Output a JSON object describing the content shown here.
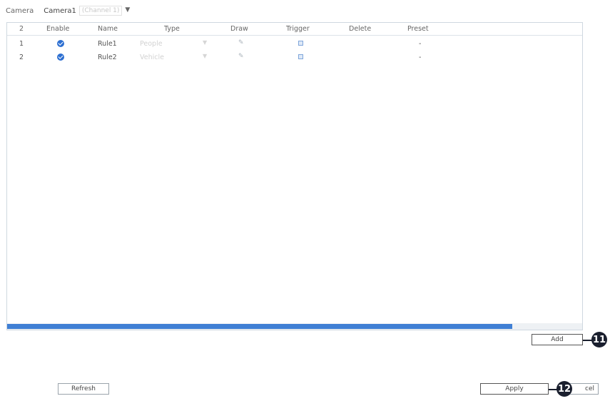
{
  "topbar": {
    "camera_label": "Camera",
    "camera_value": "Camera1",
    "channel_hint": "(Channel 1)"
  },
  "table": {
    "headers": {
      "count": "2",
      "enable": "Enable",
      "name": "Name",
      "type": "Type",
      "draw": "Draw",
      "trigger": "Trigger",
      "delete": "Delete",
      "preset": "Preset"
    },
    "rows": [
      {
        "index": "1",
        "enabled": true,
        "name": "Rule1",
        "type": "People",
        "preset": "-"
      },
      {
        "index": "2",
        "enabled": true,
        "name": "Rule2",
        "type": "Vehicle",
        "preset": "-"
      }
    ]
  },
  "scrollbar": {
    "position_fraction": 0.0
  },
  "buttons": {
    "add": "Add",
    "refresh": "Refresh",
    "apply": "Apply",
    "cancel_partial": "cel"
  },
  "callouts": {
    "add": "11",
    "apply": "12"
  },
  "colors": {
    "accent": "#3f7fd4",
    "check": "#2d6fd1",
    "callout": "#1a1f2e"
  }
}
